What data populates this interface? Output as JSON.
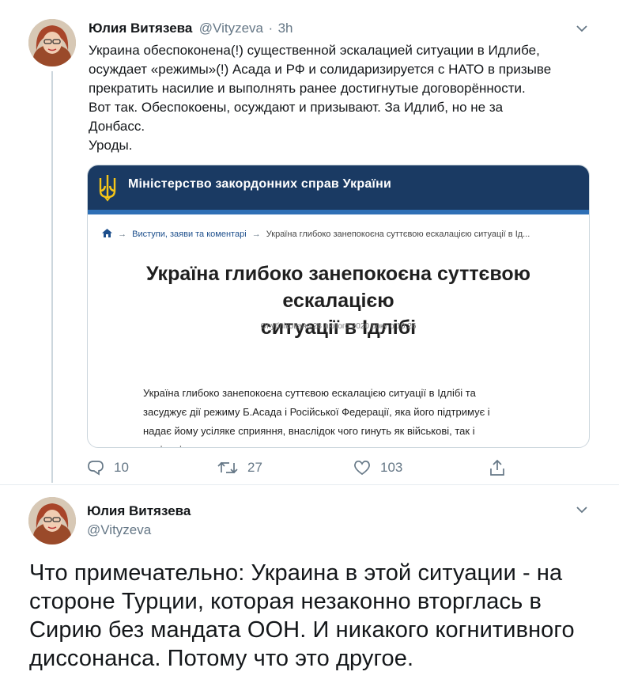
{
  "tweet1": {
    "author_name": "Юлия Витязева",
    "handle": "@Vityzeva",
    "separator": "·",
    "time": "3h",
    "text_lines": [
      "Украина обеспоконена(!) существенной эскалацией ситуации в Идлибе,",
      "осуждает «режимы»(!) Асада и РФ и солидаризируется с НАТО в призыве",
      "прекратить насилие и выполнять ранее достигнутые договорённости.",
      "Вот так. Обеспокоены, осуждают и призывают. За Идлиб, но не за",
      "Донбасс.",
      "Уроды."
    ],
    "card": {
      "site_title": "Міністерство закордонних справ України",
      "breadcrumb_1": "Виступи, заяви та коментарі",
      "breadcrumb_2": "Україна глибоко занепокоєна суттєвою ескалацією ситуації в Ід...",
      "headline_line1": "Україна глибоко занепокоєна суттєвою ескалацією",
      "headline_line2": "ситуації в Ідлібі",
      "published": "Опубліковано 28 лютого 2020 року о 10:26",
      "body_lines": [
        "Україна глибоко занепокоєна суттєвою ескалацією ситуації в Ідлібі та",
        "засуджує дії режиму Б.Асада і Російської Федерації, яка його підтримує і",
        "надає йому усіляке сприяння, внаслідок чого гинуть як військові, так і",
        "цивільні."
      ]
    },
    "actions": {
      "replies": "10",
      "retweets": "27",
      "likes": "103"
    }
  },
  "tweet2": {
    "author_name": "Юлия Витязева",
    "handle": "@Vityzeva",
    "text_lines": [
      "Что примечательно: Украина в этой ситуации - на",
      "стороне Турции, которая незаконно вторглась в",
      "Сирию без мандата ООН. И никакого когнитивного",
      "диссонанса. Потому что это другое."
    ]
  },
  "colors": {
    "secondary_text": "#657786",
    "card_header": "#1a3a63",
    "icon_gray": "#657786"
  },
  "icons": [
    "chevron-down-icon",
    "reply-icon",
    "retweet-icon",
    "like-icon",
    "share-icon",
    "home-icon",
    "trident-icon"
  ]
}
